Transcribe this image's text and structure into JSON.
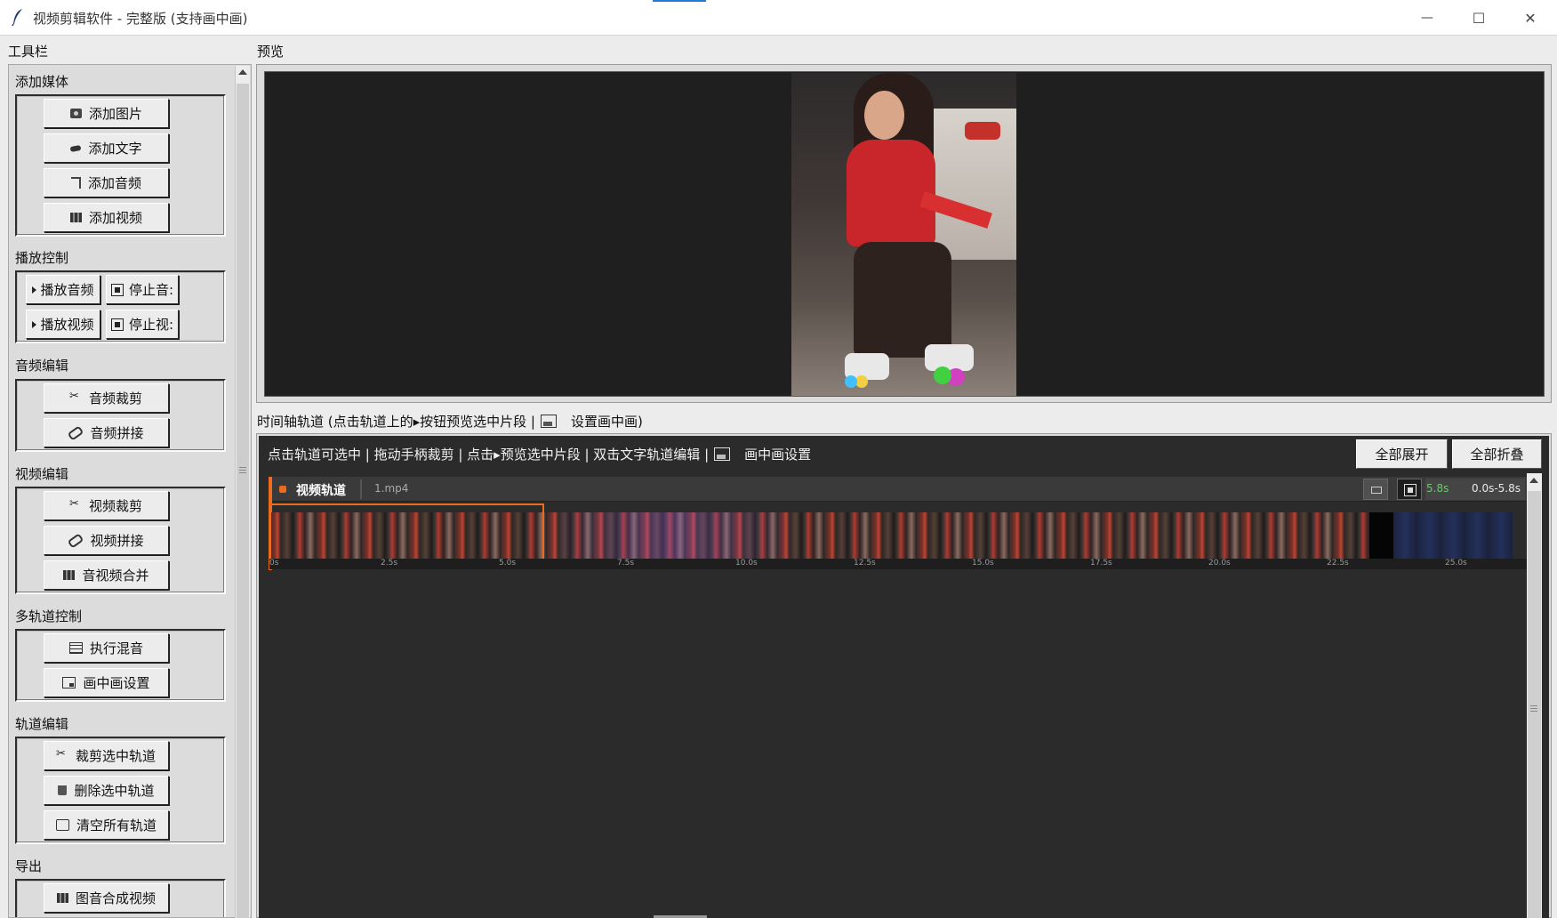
{
  "window": {
    "title": "视频剪辑软件 - 完整版 (支持画中画)",
    "minimize_glyph": "—",
    "maximize_glyph": "☐",
    "close_glyph": "✕"
  },
  "toolbar_label": "工具栏",
  "preview_label": "预览",
  "sidebar": {
    "add_media": {
      "label": "添加媒体",
      "add_image": "添加图片",
      "add_text": "添加文字",
      "add_audio": "添加音频",
      "add_video": "添加视频"
    },
    "playback": {
      "label": "播放控制",
      "play_audio": "播放音频",
      "stop_audio": "停止音:",
      "play_video": "播放视频",
      "stop_video": "停止视:"
    },
    "audio_edit": {
      "label": "音频编辑",
      "audio_trim": "音频裁剪",
      "audio_concat": "音频拼接"
    },
    "video_edit": {
      "label": "视频编辑",
      "video_trim": "视频裁剪",
      "video_concat": "视频拼接",
      "av_merge": "音视频合并"
    },
    "multitrack": {
      "label": "多轨道控制",
      "mix": "执行混音",
      "pip_settings": "画中画设置"
    },
    "track_edit": {
      "label": "轨道编辑",
      "trim_selected": "裁剪选中轨道",
      "delete_selected": "删除选中轨道",
      "clear_all": "清空所有轨道"
    },
    "export": {
      "label": "导出",
      "image_audio_video": "图音合成视频"
    }
  },
  "timeline": {
    "label_prefix": "时间轴轨道 (点击轨道上的▸按钮预览选中片段 |",
    "label_suffix": "设置画中画)",
    "hint_text": "点击轨道可选中 | 拖动手柄裁剪 | 点击▸预览选中片段 | 双击文字轨道编辑 |",
    "hint_suffix": "画中画设置",
    "expand_all": "全部展开",
    "collapse_all": "全部折叠",
    "track": {
      "name": "视频轨道",
      "file": "1.mp4",
      "duration": "5.8s",
      "range": "0.0s-5.8s"
    },
    "ruler_ticks": [
      "0s",
      "2.5s",
      "5.0s",
      "7.5s",
      "10.0s",
      "12.5s",
      "15.0s",
      "17.5s",
      "20.0s",
      "22.5s",
      "25.0s"
    ]
  },
  "colors": {
    "accent": "#ee6a1c",
    "timeline_bg": "#2b2b2b",
    "preview_bg": "#1f1f1f",
    "duration_text": "#66cc66"
  }
}
